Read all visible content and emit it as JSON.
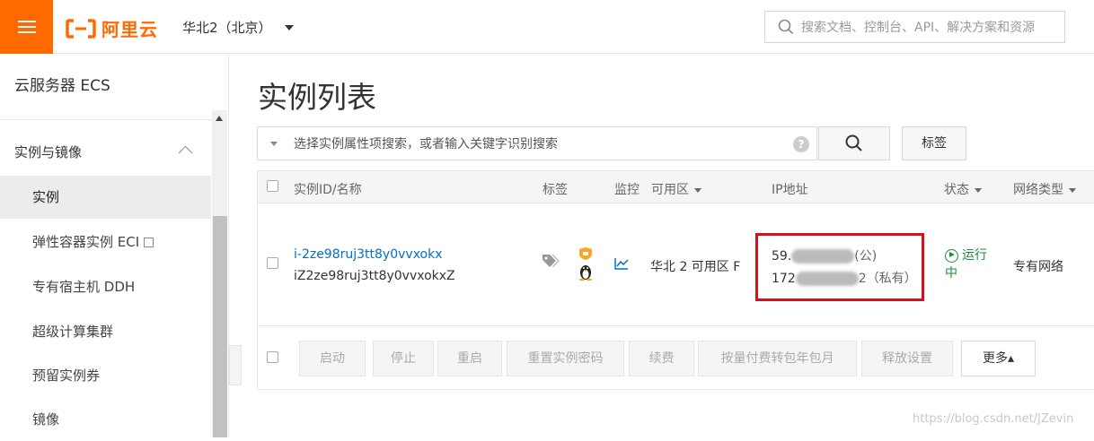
{
  "header": {
    "brand": "阿里云",
    "region": "华北2（北京）",
    "search_placeholder": "搜索文档、控制台、API、解决方案和资源"
  },
  "sidebar": {
    "title": "云服务器 ECS",
    "group": "实例与镜像",
    "items": [
      {
        "label": "实例"
      },
      {
        "label": "弹性容器实例 ECI"
      },
      {
        "label": "专有宿主机 DDH"
      },
      {
        "label": "超级计算集群"
      },
      {
        "label": "预留实例券"
      },
      {
        "label": "镜像"
      }
    ]
  },
  "main": {
    "title": "实例列表",
    "filter_placeholder": "选择实例属性项搜索，或者输入关键字识别搜索",
    "help": "?",
    "tag_button": "标签",
    "columns": {
      "id_name": "实例ID/名称",
      "tags": "标签",
      "monitor": "监控",
      "zone": "可用区",
      "ip": "IP地址",
      "status": "状态",
      "network": "网络类型"
    },
    "rows": [
      {
        "id": "i-2ze98ruj3tt8y0vvxokx",
        "name": "iZ2ze98ruj3tt8y0vvxokxZ",
        "zone": "华北 2 可用区 F",
        "public_ip_prefix": "59.",
        "public_ip_suffix": "(公)",
        "private_ip_prefix": "172",
        "private_ip_suffix": "2（私有）",
        "status_line1": "运行",
        "status_line2": "中",
        "network": "专有网络"
      }
    ],
    "actions": [
      "启动",
      "停止",
      "重启",
      "重置实例密码",
      "续费",
      "按量付费转包年包月",
      "释放设置"
    ],
    "more": "更多▴"
  },
  "watermark": "https://blog.csdn.net/JZevin",
  "colors": {
    "brand_orange": "#ff6a00",
    "link_blue": "#0070cc",
    "running_green": "#1e8e3e",
    "highlight_red": "#d0141a"
  }
}
